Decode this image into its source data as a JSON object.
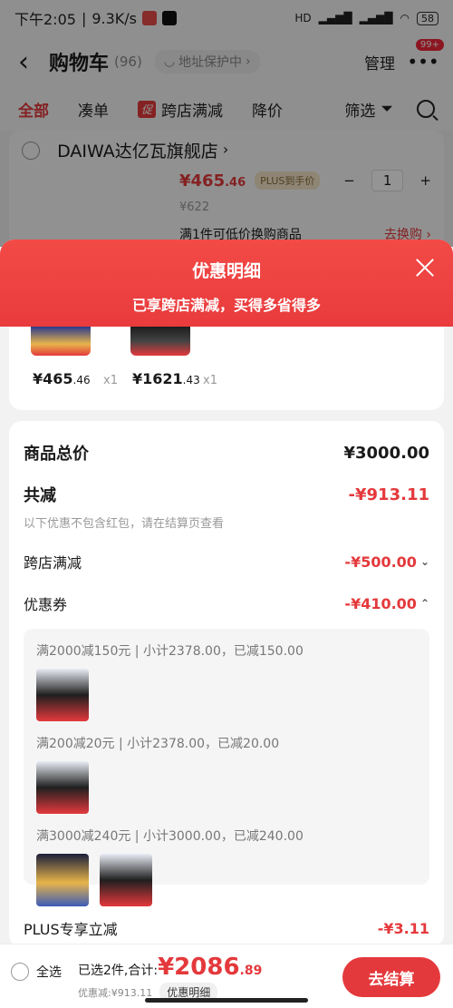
{
  "status_bar": {
    "time": "下午2:05",
    "speed": "9.3K/s",
    "battery": "58",
    "network": "HD"
  },
  "header": {
    "title": "购物车",
    "count": "(96)",
    "address": "地址保护中",
    "manage": "管理",
    "badge": "99+"
  },
  "tabs": [
    {
      "label": "全部",
      "active": true
    },
    {
      "label": "凑单"
    },
    {
      "label": "跨店满减",
      "chip": "促"
    },
    {
      "label": "降价"
    },
    {
      "label": "筛选"
    }
  ],
  "store": {
    "name": "DAIWA达亿瓦旗舰店",
    "price_main": "¥465",
    "price_dec": ".46",
    "plus_tag": "PLUS到手价",
    "qty": "1",
    "orig_price": "¥622",
    "swap_note": "满1件可低价换购商品",
    "swap_link": "去换购"
  },
  "sheet": {
    "title": "优惠明细",
    "subtitle": "已享跨店满减，买得多省得多",
    "items": [
      {
        "price": "¥465",
        "dec": ".46",
        "qty": "x1"
      },
      {
        "price": "¥1621",
        "dec": ".43",
        "qty": "x1"
      }
    ],
    "total_label": "商品总价",
    "total_value": "¥3000.00",
    "reduce_label": "共减",
    "reduce_value": "-¥913.11",
    "note": "以下优惠不包含红包，请在结算页查看",
    "cross_label": "跨店满减",
    "cross_value": "-¥500.00",
    "coupon_label": "优惠券",
    "coupon_value": "-¥410.00",
    "coupons": [
      "满2000减150元 | 小计2378.00，已减150.00",
      "满200减20元 | 小计2378.00，已减20.00",
      "满3000减240元 | 小计3000.00，已减240.00"
    ],
    "plus_label": "PLUS专享立减",
    "plus_value": "-¥3.11"
  },
  "bottom": {
    "select_all": "全选",
    "selected": "已选2件,合计:",
    "total_main": "¥2086",
    "total_dec": ".89",
    "discount": "优惠减:¥913.11",
    "detail_btn": "优惠明细",
    "checkout": "去结算"
  },
  "colors": {
    "brand_red": "#e4393c",
    "sheet_head": "#f24a46"
  }
}
